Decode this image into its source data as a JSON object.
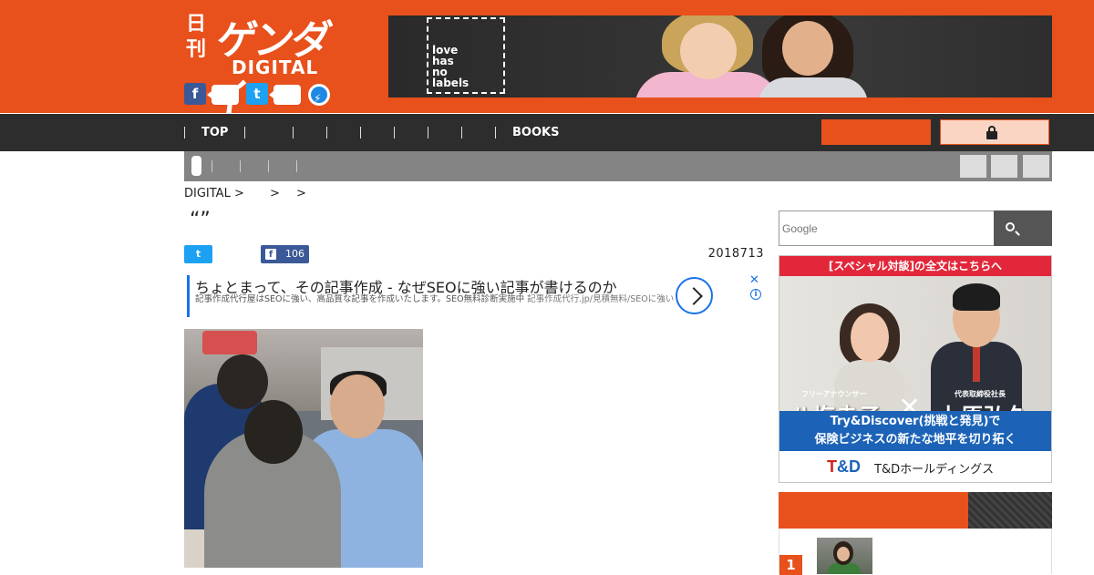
{
  "header": {
    "logo_kan": "日刊",
    "logo_gendai": "ゲンダイ",
    "logo_digital": "DIGITAL",
    "social": [
      {
        "name": "facebook",
        "glyph": "f",
        "color": "#3b5998"
      },
      {
        "name": "twitter",
        "glyph": "t",
        "color": "#1da1f2"
      },
      {
        "name": "messenger",
        "glyph": "⚡",
        "color": "#1e88e5"
      }
    ],
    "brand_color": "#e8501c"
  },
  "banner_ad": {
    "label": "love\nhas\nno\nlabels"
  },
  "nav": {
    "items": [
      "TOP",
      "",
      "",
      "",
      "",
      "",
      "",
      "",
      "BOOKS"
    ],
    "lock_icon": "lock-icon"
  },
  "breadcrumb": {
    "items": [
      "DIGITAL >",
      ">",
      ">"
    ]
  },
  "article": {
    "title_quote": "“”",
    "facebook_count": "106",
    "date": "2018713"
  },
  "text_ad": {
    "title": "ちょとまって、その記事作成 - なぜSEOに強い記事が書けるのか",
    "description": "記事作成代行屋はSEOに強い、高品質な記事を作成いたします。SEO無料診断実施中",
    "url_text": "記事作成代行.jp/見積無料/SEOに強い",
    "close_glyph": "✕",
    "info_glyph": "i"
  },
  "search": {
    "placeholder": "Google"
  },
  "side_ad": {
    "top_text": "[スペシャル対談]の全文はこちらへ",
    "left_title": "フリーアナウンサー",
    "left_name": "八塩圭子",
    "cross": "✕",
    "right_title": "代表取締役社長",
    "right_name": "上原弘久",
    "line1": "Try&Discover(挑戦と発見)で",
    "line2": "保険ビジネスの新たな地平を切り拓く",
    "brand_mark_t": "T",
    "brand_mark_d": "&D",
    "brand_name": "T&Dホールディングス"
  },
  "ranking": {
    "first_number": "1"
  }
}
